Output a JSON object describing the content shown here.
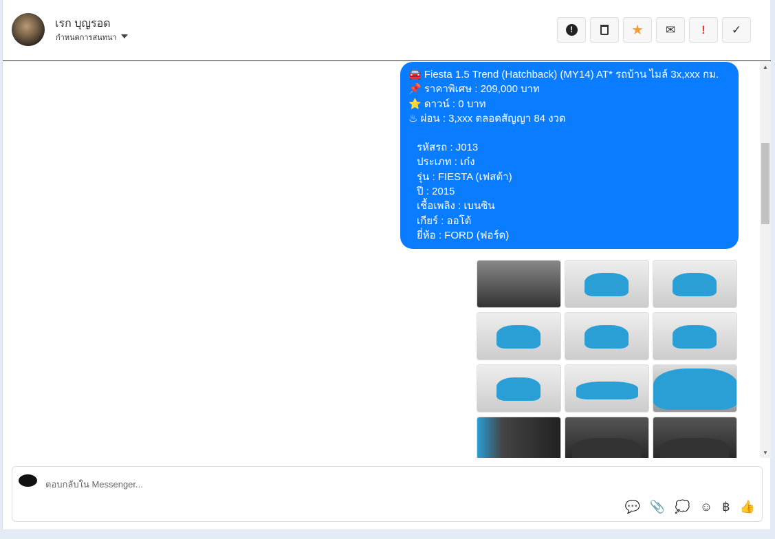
{
  "header": {
    "contact_name": "เรก บุญรอด",
    "conversation_menu": "กำหนดการสนทนา",
    "tools": [
      {
        "icon": "exclamation-circle-icon",
        "glyph": "❗"
      },
      {
        "icon": "trash-icon",
        "glyph": "🗑"
      },
      {
        "icon": "star-icon",
        "glyph": "★",
        "color": "#f39c3c"
      },
      {
        "icon": "envelope-icon",
        "glyph": "✉"
      },
      {
        "icon": "exclamation-icon",
        "glyph": "!",
        "color": "#e53935"
      },
      {
        "icon": "check-icon",
        "glyph": "✓"
      }
    ]
  },
  "message": {
    "lines": [
      "🚘 Fiesta 1.5 Trend (Hatchback) (MY14) AT* รถบ้าน ไมล์ 3x,xxx กม.",
      "📌 ราคาพิเศษ : 209,000 บาท",
      "⭐ ดาวน์ : 0 บาท",
      "♨ ผ่อน : 3,xxx ตลอดสัญญา 84 งวด"
    ],
    "details": [
      "รหัสรถ : J013",
      "ประเภท : เก๋ง",
      "รุ่น : FIESTA (เฟสต้า)",
      "ปี : 2015",
      "เชื้อเพลิง : เบนซิน",
      "เกียร์ : ออโต้",
      "ยี่ห้อ : FORD (ฟอร์ด)"
    ],
    "bubble_color": "#0a7cff"
  },
  "composer": {
    "placeholder": "ตอบกลับใน Messenger...",
    "icons": [
      {
        "icon": "saved-reply-icon",
        "glyph": "💬"
      },
      {
        "icon": "paperclip-icon",
        "glyph": "📎"
      },
      {
        "icon": "quick-reply-icon",
        "glyph": "💭"
      },
      {
        "icon": "emoji-icon",
        "glyph": "☺"
      },
      {
        "icon": "baht-icon",
        "glyph": "฿"
      },
      {
        "icon": "thumbs-up-icon",
        "glyph": "👍"
      }
    ]
  }
}
